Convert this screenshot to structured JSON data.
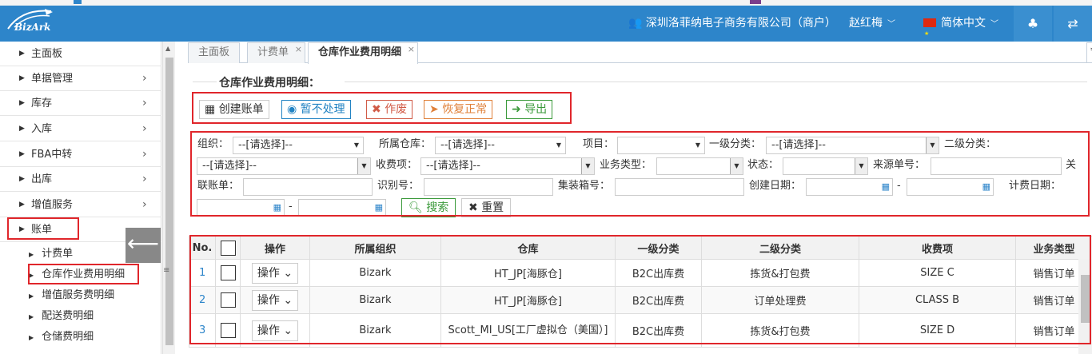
{
  "header": {
    "logo_text": "BizArk",
    "company": "深圳洛菲纳电子商务有限公司（商户）",
    "user": "赵红梅",
    "language": "简体中文",
    "colors": {
      "bar": "#2d85ca",
      "accent_red": "#e0262b"
    }
  },
  "sidebar": {
    "items": [
      {
        "label": "主面板"
      },
      {
        "label": "单据管理"
      },
      {
        "label": "库存"
      },
      {
        "label": "入库"
      },
      {
        "label": "FBA中转"
      },
      {
        "label": "出库"
      },
      {
        "label": "增值服务"
      },
      {
        "label": "账单"
      }
    ],
    "sub_items": [
      {
        "label": "计费单"
      },
      {
        "label": "仓库作业费用明细"
      },
      {
        "label": "增值服务费明细"
      },
      {
        "label": "配送费明细"
      },
      {
        "label": "仓储费明细"
      }
    ]
  },
  "tabs": [
    {
      "label": "主面板"
    },
    {
      "label": "计费单"
    },
    {
      "label": "仓库作业费用明细"
    }
  ],
  "panel": {
    "title": "仓库作业费用明细："
  },
  "actions": {
    "create": "创建账单",
    "hold": "暂不处理",
    "void": "作废",
    "restore": "恢复正常",
    "export": "导出"
  },
  "filters": {
    "org_label": "组织：",
    "org_value": "--[请选择]--",
    "warehouse_label": "所属仓库：",
    "warehouse_value": "--[请选择]--",
    "project_label": "项目：",
    "cat1_label": "一级分类：",
    "cat1_value": "--[请选择]--",
    "cat2_label": "二级分类：",
    "cat2_value": "--[请选择]--",
    "fee_label": "收费项：",
    "fee_value": "--[请选择]--",
    "biz_type_label": "业务类型：",
    "status_label": "状态：",
    "source_no_label": "来源单号：",
    "cut_label": "关",
    "linked_bill_label": "联账单：",
    "ident_label": "识别号：",
    "container_label": "集装箱号：",
    "created_label": "创建日期：",
    "billing_date_label": "计费日期：",
    "range_sep": "-",
    "search": "搜索",
    "reset": "重置"
  },
  "table": {
    "headers": [
      "No.",
      "",
      "操作",
      "所属组织",
      "仓库",
      "一级分类",
      "二级分类",
      "收费项",
      "业务类型"
    ],
    "op_label": "操作",
    "rows": [
      {
        "no": "1",
        "org": "Bizark",
        "warehouse": "HT_JP[海豚仓]",
        "cat1": "B2C出库费",
        "cat2": "拣货&打包费",
        "fee": "SIZE C",
        "biz": "销售订单"
      },
      {
        "no": "2",
        "org": "Bizark",
        "warehouse": "HT_JP[海豚仓]",
        "cat1": "B2C出库费",
        "cat2": "订单处理费",
        "fee": "CLASS B",
        "biz": "销售订单"
      },
      {
        "no": "3",
        "org": "Bizark",
        "warehouse": "Scott_MI_US[工厂虚拟仓（美国）]",
        "cat1": "B2C出库费",
        "cat2": "拣货&打包费",
        "fee": "SIZE D",
        "biz": "销售订单"
      }
    ]
  }
}
